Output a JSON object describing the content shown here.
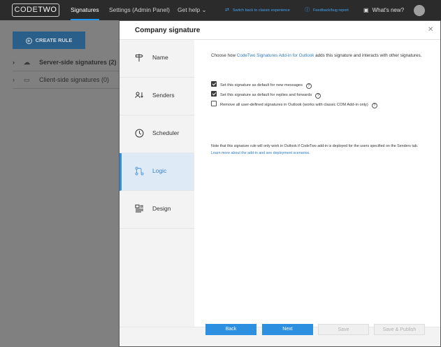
{
  "topbar": {
    "logo_a": "CODE",
    "logo_b": "TWO",
    "tabs": [
      {
        "label": "Signatures",
        "active": true
      },
      {
        "label": "Settings (Admin Panel)",
        "active": false
      },
      {
        "label": "Get help ⌄",
        "active": false
      }
    ],
    "switch_link": "Switch back to classic experience",
    "feedback_link": "Feedback/bug report",
    "whats_new": "What's new?"
  },
  "background": {
    "create_rule": "CREATE RULE",
    "tree": [
      {
        "label": "Server-side signatures (2)",
        "icon": "cloud-icon",
        "bold": true
      },
      {
        "label": "Client-side signatures (0)",
        "icon": "monitor-icon",
        "bold": false
      }
    ]
  },
  "modal": {
    "title": "Company signature",
    "steps": [
      {
        "label": "Name",
        "icon": "signpost-icon"
      },
      {
        "label": "Senders",
        "icon": "senders-icon"
      },
      {
        "label": "Scheduler",
        "icon": "clock-icon"
      },
      {
        "label": "Logic",
        "icon": "logic-icon",
        "active": true
      },
      {
        "label": "Design",
        "icon": "design-icon"
      }
    ],
    "intro_pre": "Choose how ",
    "intro_link": "CodeTwo Signatures Add-in for Outlook",
    "intro_post": " adds this signature and interacts with other signatures.",
    "options": [
      {
        "label": "Set this signature as default for new messages",
        "checked": true
      },
      {
        "label": "Set this signature as default for replies and forwards",
        "checked": true
      },
      {
        "label": "Remove all user-defined signatures in Outlook (works with classic COM Add-in only)",
        "checked": false
      }
    ],
    "note_pre": "Note that this signature rule will only work in Outlook if CodeTwo add-in is deployed for the users specified on the Senders tab. ",
    "note_link": "Learn more about the add-in and see deployment scenarios.",
    "buttons": {
      "back": "Back",
      "next": "Next",
      "save": "Save",
      "save_publish": "Save & Publish"
    }
  },
  "colors": {
    "accent": "#2d8fe0",
    "topbar": "#2b2b2b",
    "active_step_bg": "#deebf7"
  }
}
